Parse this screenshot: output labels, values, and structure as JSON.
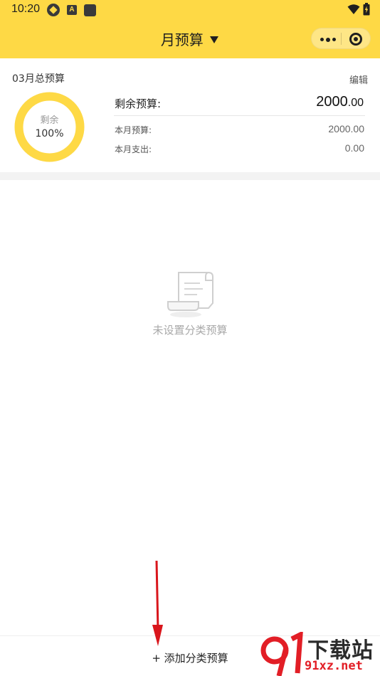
{
  "status_bar": {
    "time": "10:20",
    "app_icon_letter": "A"
  },
  "nav": {
    "title": "月预算",
    "dropdown_icon": "caret-down-icon",
    "more_icon": "more-dots-icon",
    "close_icon": "target-close-icon"
  },
  "budget": {
    "title": "03月总预算",
    "edit_label": "编辑",
    "ring_label": "剩余",
    "ring_percent": "100%",
    "remaining_fraction": 1.0,
    "remain_label": "剩余预算:",
    "remain_int": "2000",
    "remain_dec": ".00",
    "month_budget_label": "本月预算:",
    "month_budget_value": "2000.00",
    "month_spent_label": "本月支出:",
    "month_spent_value": "0.00",
    "accent_color": "#fed945"
  },
  "empty_state": {
    "icon": "scroll-document-icon",
    "text": "未设置分类预算"
  },
  "bottom": {
    "add_label": "+ 添加分类预算"
  },
  "watermark": {
    "logo": "91-logo-icon",
    "text_top": "下载站",
    "text_bottom": "91xz.net"
  }
}
